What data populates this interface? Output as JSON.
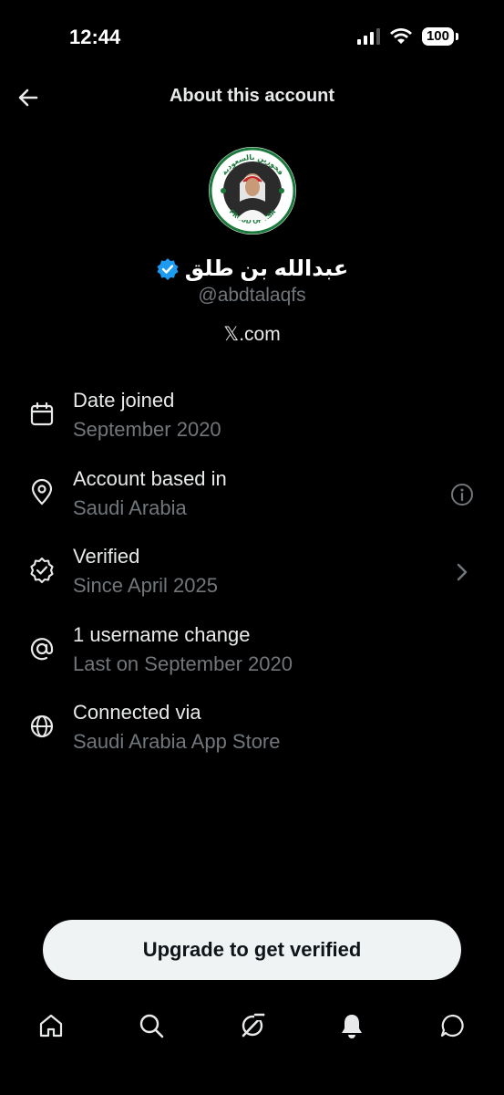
{
  "status": {
    "time": "12:44",
    "battery": "100"
  },
  "header": {
    "title": "About this account"
  },
  "profile": {
    "avatar_text_top": "فخورين بالسعودية",
    "avatar_text_bottom": "PROUD OF KSA",
    "display_name": "عبدالله بن طلق",
    "handle": "@abdtalaqfs",
    "site": "𝕏.com"
  },
  "info": [
    {
      "title": "Date joined",
      "subtitle": "September 2020",
      "icon": "calendar-icon"
    },
    {
      "title": "Account based in",
      "subtitle": "Saudi Arabia",
      "icon": "location-pin-icon",
      "trailing": "info-icon"
    },
    {
      "title": "Verified",
      "subtitle": "Since April 2025",
      "icon": "verified-shield-icon",
      "trailing": "chevron-right-icon"
    },
    {
      "title": "1 username change",
      "subtitle": "Last on September 2020",
      "icon": "at-sign-icon"
    },
    {
      "title": "Connected via",
      "subtitle": "Saudi Arabia App Store",
      "icon": "globe-icon"
    }
  ],
  "cta": {
    "label": "Upgrade to get verified"
  },
  "tabs": [
    "home-icon",
    "search-icon",
    "grok-icon",
    "notifications-icon",
    "messages-icon"
  ],
  "colors": {
    "background": "#000000",
    "text": "#e7e9ea",
    "muted": "#71767b",
    "verified_blue": "#1d9bf0",
    "button_bg": "#eff3f4"
  }
}
